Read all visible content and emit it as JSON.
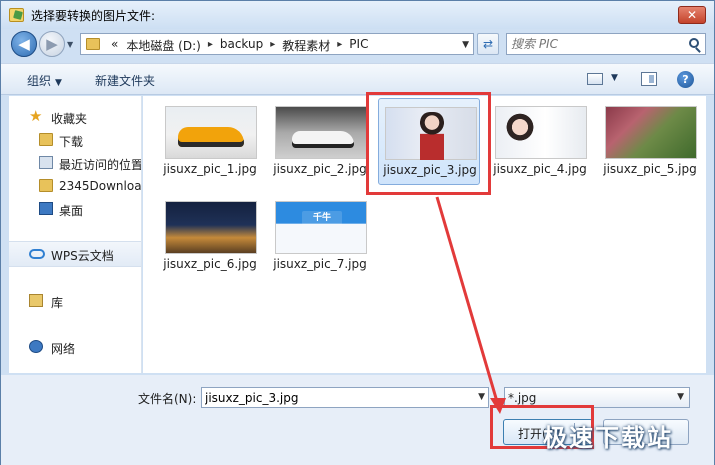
{
  "window": {
    "title": "选择要转换的图片文件:",
    "close_label": "✕"
  },
  "address": {
    "crumbs_prefix": "«",
    "crumbs": [
      "本地磁盘 (D:)",
      "backup",
      "教程素材",
      "PIC"
    ],
    "separator": "▸"
  },
  "search": {
    "placeholder": "搜索 PIC"
  },
  "toolbar": {
    "organize_label": "组织",
    "new_folder_label": "新建文件夹",
    "help_label": "?"
  },
  "sidebar": {
    "items": [
      {
        "label": "收藏夹",
        "icon": "star-icon"
      },
      {
        "label": "下载",
        "icon": "folder-icon"
      },
      {
        "label": "最近访问的位置",
        "icon": "recent-places-icon"
      },
      {
        "label": "2345Downloa",
        "icon": "folder-icon"
      },
      {
        "label": "桌面",
        "icon": "desktop-icon"
      },
      {
        "label": "WPS云文档",
        "icon": "cloud-icon"
      },
      {
        "label": "库",
        "icon": "library-icon"
      },
      {
        "label": "网络",
        "icon": "network-icon"
      }
    ]
  },
  "files": [
    {
      "name": "jisuxz_pic_1.jpg",
      "selected": false
    },
    {
      "name": "jisuxz_pic_2.jpg",
      "selected": false
    },
    {
      "name": "jisuxz_pic_3.jpg",
      "selected": true
    },
    {
      "name": "jisuxz_pic_4.jpg",
      "selected": false
    },
    {
      "name": "jisuxz_pic_5.jpg",
      "selected": false
    },
    {
      "name": "jisuxz_pic_6.jpg",
      "selected": false
    },
    {
      "name": "jisuxz_pic_7.jpg",
      "selected": false
    }
  ],
  "pic7_logo_text": "千牛",
  "bottom": {
    "filename_label": "文件名(N):",
    "filename_value": "jisuxz_pic_3.jpg",
    "filetype_value": "*.jpg",
    "open_label": "打开(O)"
  },
  "watermark": "极速下载站",
  "colors": {
    "accent": "#3c7fb1",
    "annotation_red": "#e23a3a",
    "selection_bg": "#cfe4fb"
  }
}
